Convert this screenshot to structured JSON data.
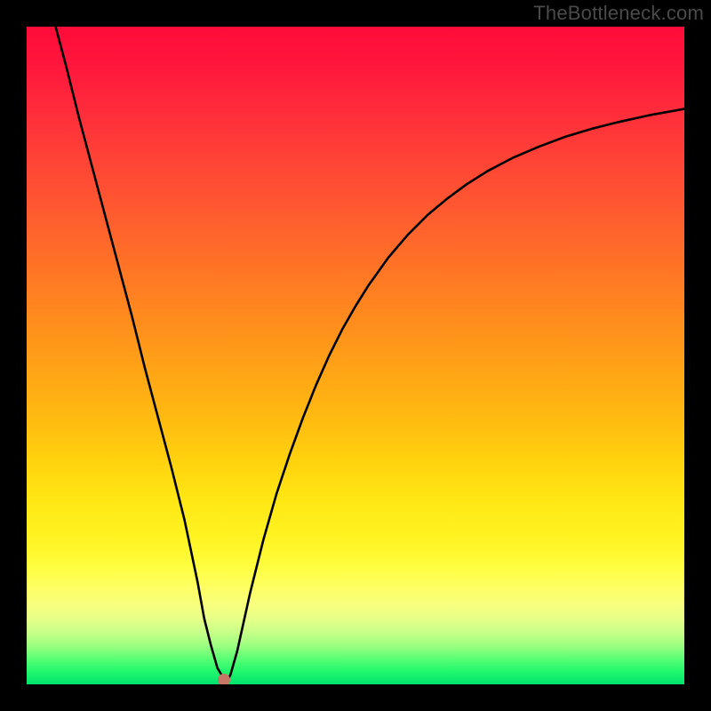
{
  "watermark": "TheBottleneck.com",
  "chart_data": {
    "type": "line",
    "title": "",
    "xlabel": "",
    "ylabel": "",
    "xlim": [
      0,
      100
    ],
    "ylim": [
      0,
      100
    ],
    "grid": false,
    "legend": false,
    "marker": {
      "x": 30.0,
      "y": 0.7
    },
    "series": [
      {
        "name": "bottleneck-curve",
        "x": [
          4.4,
          6,
          8,
          10,
          12,
          14,
          16,
          18,
          20,
          22,
          24,
          26,
          27,
          28,
          29,
          30,
          30.5,
          31,
          32,
          33,
          34,
          36,
          38,
          40,
          42,
          44,
          46,
          48,
          50,
          52,
          55,
          58,
          61,
          64,
          67,
          70,
          74,
          78,
          82,
          86,
          90,
          95,
          100
        ],
        "y": [
          100,
          94,
          86,
          78.5,
          71,
          63.5,
          56,
          48,
          40.5,
          33,
          25,
          15.5,
          10,
          6,
          2.5,
          0.8,
          0.5,
          1.5,
          5,
          9.5,
          14,
          22,
          29,
          35,
          40.5,
          45.5,
          50,
          54,
          57.5,
          60.7,
          64.9,
          68.4,
          71.4,
          73.9,
          76.1,
          78.0,
          80.1,
          81.8,
          83.3,
          84.5,
          85.5,
          86.6,
          87.5
        ]
      }
    ],
    "background_gradient": {
      "orientation": "vertical",
      "stops": [
        {
          "pos": 0.0,
          "color": "#ff0b3a"
        },
        {
          "pos": 0.5,
          "color": "#ff9d1a"
        },
        {
          "pos": 0.8,
          "color": "#fffb36"
        },
        {
          "pos": 1.0,
          "color": "#00e36e"
        }
      ]
    }
  }
}
